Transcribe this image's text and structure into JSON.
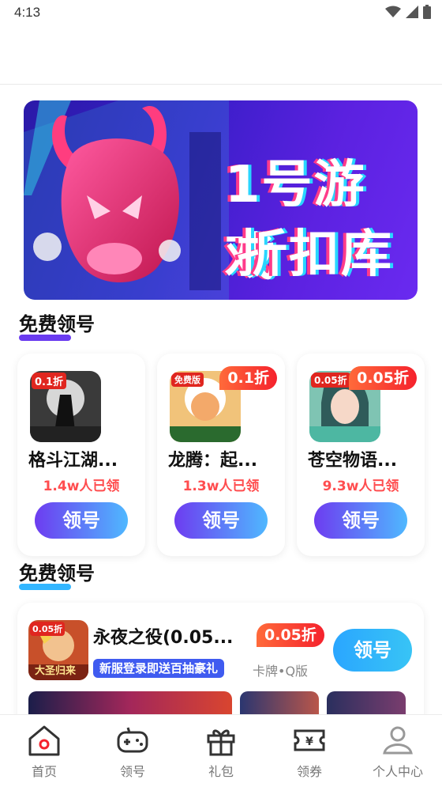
{
  "status_bar": {
    "time": "4:13",
    "icons": [
      "wifi-icon",
      "signal-icon",
      "battery-icon"
    ]
  },
  "banner": {
    "line1": "1号游戏",
    "line2": "折扣库"
  },
  "sections": [
    {
      "title": "免费领号",
      "accent": "#6b3cf0"
    },
    {
      "title": "免费领号",
      "accent": "#33b6ff"
    }
  ],
  "cards": [
    {
      "name": "格斗江湖...",
      "count": "1.4w人已领",
      "button": "领号",
      "discount": "",
      "icon_badge": "0.1折"
    },
    {
      "name": "龙腾：起...",
      "count": "1.3w人已领",
      "button": "领号",
      "discount": "0.1折",
      "icon_badge": "免费版"
    },
    {
      "name": "苍空物语...",
      "count": "9.3w人已领",
      "button": "领号",
      "discount": "0.05折",
      "icon_badge": "0.05折"
    }
  ],
  "list_item": {
    "name": "永夜之役(0.05...",
    "discount": "0.05折",
    "tag": "新服登录即送百抽豪礼",
    "category": "卡牌•Q版",
    "button": "领号",
    "icon_badge": "0.05折",
    "icon_caption": "大圣归来"
  },
  "tabs": [
    {
      "label": "首页",
      "icon": "home-icon",
      "active": true
    },
    {
      "label": "领号",
      "icon": "gamepad-icon",
      "active": false
    },
    {
      "label": "礼包",
      "icon": "gift-icon",
      "active": false
    },
    {
      "label": "领券",
      "icon": "coupon-icon",
      "active": false
    },
    {
      "label": "个人中心",
      "icon": "user-icon",
      "active": false
    }
  ],
  "colors": {
    "accent_red": "#f5222d",
    "accent_purple": "#6d3cf0",
    "accent_blue": "#2aa6ff"
  }
}
